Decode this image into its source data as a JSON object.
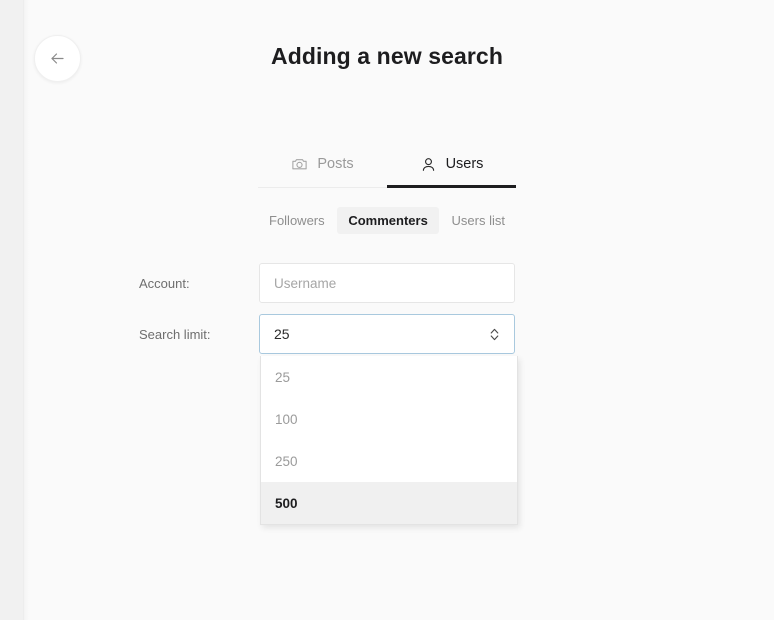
{
  "window": {
    "title": "Adding a new search",
    "background_color": "#fafafa"
  },
  "back_button": {
    "icon": "arrow-left-icon",
    "label": ""
  },
  "tabs": [
    {
      "label": "Posts",
      "icon": "camera-icon",
      "active": false
    },
    {
      "label": "Users",
      "icon": "person-icon",
      "active": true
    }
  ],
  "subtabs": [
    {
      "label": "Followers",
      "active": false
    },
    {
      "label": "Commenters",
      "active": true
    },
    {
      "label": "Users list",
      "active": false
    }
  ],
  "form": {
    "account": {
      "label": "Account:",
      "placeholder": "Username",
      "value": ""
    },
    "search_limit": {
      "label": "Search limit:",
      "value": "25",
      "stepper_icon": "chevron-up-down-icon",
      "options": [
        {
          "label": "25",
          "highlighted": false
        },
        {
          "label": "100",
          "highlighted": false
        },
        {
          "label": "250",
          "highlighted": false
        },
        {
          "label": "500",
          "highlighted": true
        }
      ]
    }
  },
  "colors": {
    "active_tab_underline": "#1d1d1f",
    "select_focus_border": "#a9c9de",
    "highlight_background": "#f0f0f0",
    "label_text": "#6e6e6e"
  }
}
